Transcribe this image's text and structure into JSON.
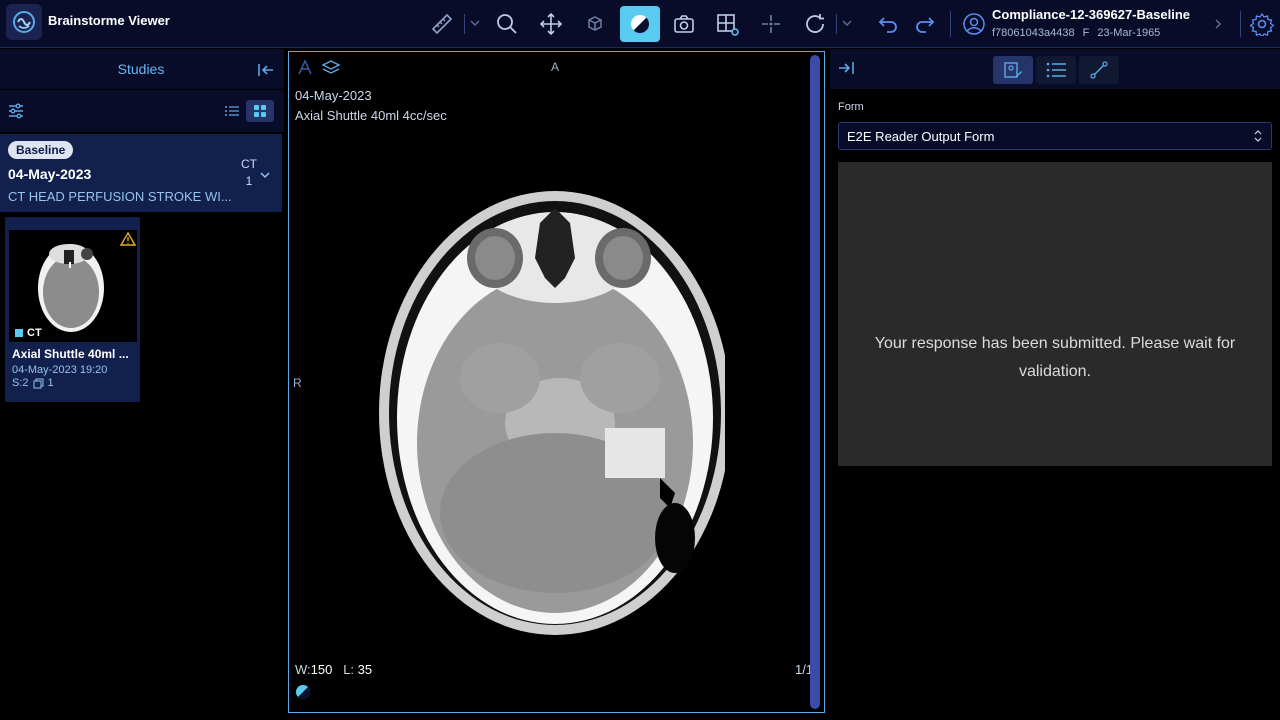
{
  "app": {
    "title": "Brainstorme Viewer"
  },
  "toolbar": {
    "tools": [
      "ruler-tool",
      "zoom-tool",
      "pan-tool",
      "rotate-3d-tool",
      "window-level-tool",
      "capture-tool",
      "layout-tool",
      "crosshair-tool",
      "reset-tool",
      "undo-tool",
      "redo-tool"
    ],
    "active_tool": "window-level-tool"
  },
  "patient": {
    "name": "Compliance-12-369627-Baseline",
    "id": "f78061043a4438",
    "sex": "F",
    "dob": "23-Mar-1965"
  },
  "left_panel": {
    "title": "Studies",
    "study": {
      "badge": "Baseline",
      "date": "04-May-2023",
      "description": "CT HEAD PERFUSION STROKE WI...",
      "modality": "CT",
      "count": "1"
    },
    "series_thumb": {
      "modality": "CT",
      "name": "Axial Shuttle 40ml ...",
      "datetime": "04-May-2023 19:20",
      "series_number": "S:2",
      "instances": "1"
    }
  },
  "viewport": {
    "orientation_top": "A",
    "orientation_left": "R",
    "date": "04-May-2023",
    "series_description": "Axial Shuttle 40ml 4cc/sec",
    "window_label": "W:",
    "window_value": "150",
    "level_label": "L:",
    "level_value": "35",
    "frame": "1/1"
  },
  "right_panel": {
    "form_label": "Form",
    "form_selected": "E2E Reader Output Form",
    "message": "Your response has been submitted. Please wait for validation."
  },
  "colors": {
    "accent": "#5acbf0",
    "header_bg": "#090c29",
    "card_bg": "#11204d",
    "link": "#64b9f0"
  }
}
